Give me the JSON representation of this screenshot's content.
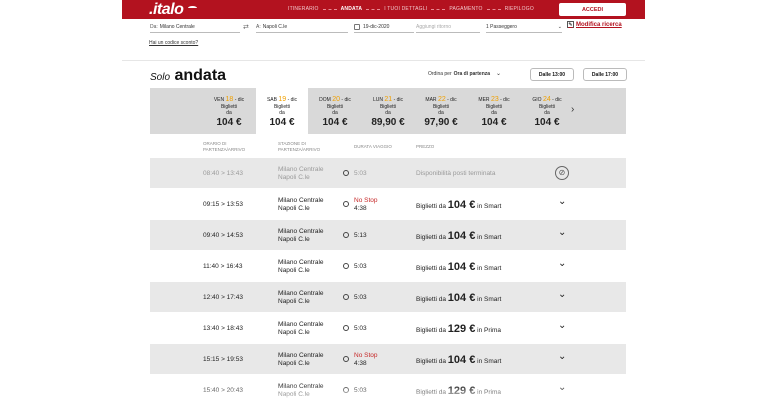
{
  "header": {
    "logo": ".italo",
    "steps": [
      "ITINERARIO",
      "ANDATA",
      "I TUOI DETTAGLI",
      "PAGAMENTO",
      "RIEPILOGO"
    ],
    "access_label": "ACCEDI"
  },
  "search": {
    "from_prefix": "Da:",
    "from_value": "Milano Centrale",
    "to_prefix": "A:",
    "to_value": "Napoli C.le",
    "date_value": "19-dic-2020",
    "return_placeholder": "Aggiungi ritorno",
    "passengers_value": "1 Passeggero",
    "modify_label": "Modifica ricerca",
    "promo_link": "Hai un codice sconto?"
  },
  "title": {
    "small": "Solo",
    "big": "andata"
  },
  "order": {
    "label": "Ordina per",
    "value": "Ora di partenza"
  },
  "filters": [
    "Dalle 13:00",
    "Dalle 17:00"
  ],
  "dates": [
    {
      "day": "VEN",
      "num": "18",
      "month": "- dic",
      "l1": "Biglietti",
      "l2": "da",
      "price": "104 €"
    },
    {
      "day": "SAB",
      "num": "19",
      "month": "- dic",
      "l1": "Biglietti",
      "l2": "da",
      "price": "104 €"
    },
    {
      "day": "DOM",
      "num": "20",
      "month": "- dic",
      "l1": "Biglietti",
      "l2": "da",
      "price": "104 €"
    },
    {
      "day": "LUN",
      "num": "21",
      "month": "- dic",
      "l1": "Biglietti",
      "l2": "da",
      "price": "89,90 €"
    },
    {
      "day": "MAR",
      "num": "22",
      "month": "- dic",
      "l1": "Biglietti",
      "l2": "da",
      "price": "97,90 €"
    },
    {
      "day": "MER",
      "num": "23",
      "month": "- dic",
      "l1": "Biglietti",
      "l2": "da",
      "price": "104 €"
    },
    {
      "day": "GIO",
      "num": "24",
      "month": "- dic",
      "l1": "Biglietti",
      "l2": "da",
      "price": "104 €"
    }
  ],
  "columns": {
    "time_1": "ORARIO DI",
    "time_2": "PARTENZA/ARRIVO",
    "station_1": "STAZIONE DI",
    "station_2": "PARTENZA/ARRIVO",
    "duration": "DURATA VIAGGIO",
    "price": "PREZZO"
  },
  "trains": [
    {
      "time": "08:40 > 13:43",
      "from": "Milano Centrale",
      "to": "Napoli C.le",
      "nostop": "",
      "dur": "5:03",
      "pre": "Disponibilità posti terminata",
      "price": "",
      "cls": ""
    },
    {
      "time": "09:15 > 13:53",
      "from": "Milano Centrale",
      "to": "Napoli C.le",
      "nostop": "No Stop",
      "dur": "4:38",
      "pre": "Biglietti da ",
      "price": "104 €",
      "cls": " in Smart"
    },
    {
      "time": "09:40 > 14:53",
      "from": "Milano Centrale",
      "to": "Napoli C.le",
      "nostop": "",
      "dur": "5:13",
      "pre": "Biglietti da ",
      "price": "104 €",
      "cls": " in Smart"
    },
    {
      "time": "11:40 > 16:43",
      "from": "Milano Centrale",
      "to": "Napoli C.le",
      "nostop": "",
      "dur": "5:03",
      "pre": "Biglietti da ",
      "price": "104 €",
      "cls": " in Smart"
    },
    {
      "time": "12:40 > 17:43",
      "from": "Milano Centrale",
      "to": "Napoli C.le",
      "nostop": "",
      "dur": "5:03",
      "pre": "Biglietti da ",
      "price": "104 €",
      "cls": " in Smart"
    },
    {
      "time": "13:40 > 18:43",
      "from": "Milano Centrale",
      "to": "Napoli C.le",
      "nostop": "",
      "dur": "5:03",
      "pre": "Biglietti da ",
      "price": "129 €",
      "cls": " in Prima"
    },
    {
      "time": "15:15 > 19:53",
      "from": "Milano Centrale",
      "to": "Napoli C.le",
      "nostop": "No Stop",
      "dur": "4:38",
      "pre": "Biglietti da ",
      "price": "104 €",
      "cls": " in Smart"
    },
    {
      "time": "15:40 > 20:43",
      "from": "Milano Centrale",
      "to": "Napoli C.le",
      "nostop": "",
      "dur": "5:03",
      "pre": "Biglietti da ",
      "price": "129 €",
      "cls": " in Prima"
    }
  ],
  "colors": {
    "brand": "#b3121f",
    "date_accent": "#f0a000",
    "nostop": "#c62828"
  }
}
